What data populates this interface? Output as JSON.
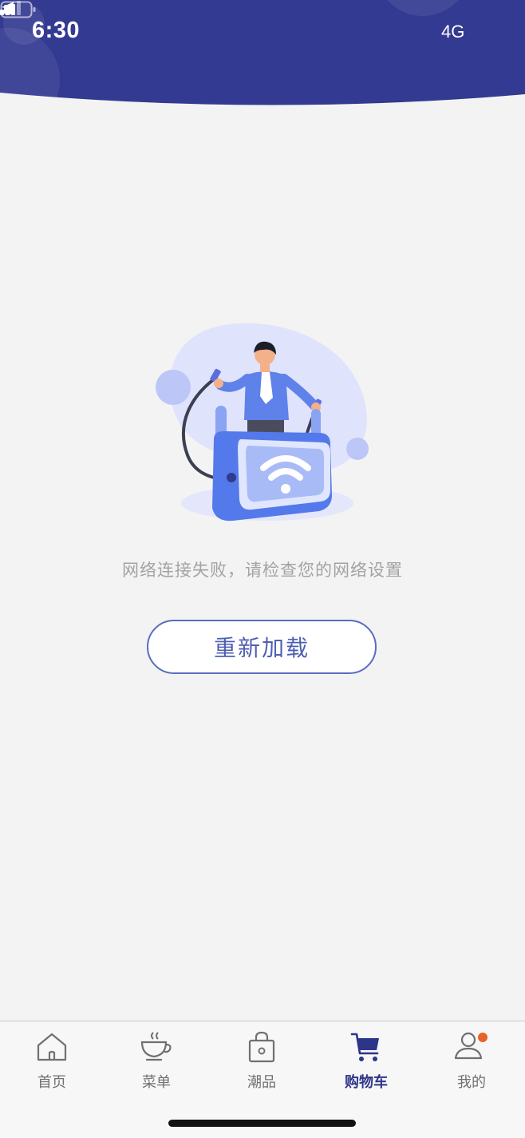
{
  "status_bar": {
    "time": "6:30",
    "network": "4G",
    "battery_fraction": 0.45
  },
  "colors": {
    "header": "#333a91",
    "accent": "#2e3588",
    "button_border": "#5a6cc0",
    "badge": "#e8622c"
  },
  "error": {
    "message": "网络连接失败，请检查您的网络设置",
    "reload_label": "重新加载"
  },
  "tabbar": {
    "active": "购物车",
    "items": [
      {
        "label": "首页",
        "icon": "home-icon"
      },
      {
        "label": "菜单",
        "icon": "cup-icon"
      },
      {
        "label": "潮品",
        "icon": "bag-icon"
      },
      {
        "label": "购物车",
        "icon": "cart-icon"
      },
      {
        "label": "我的",
        "icon": "user-icon"
      }
    ]
  }
}
